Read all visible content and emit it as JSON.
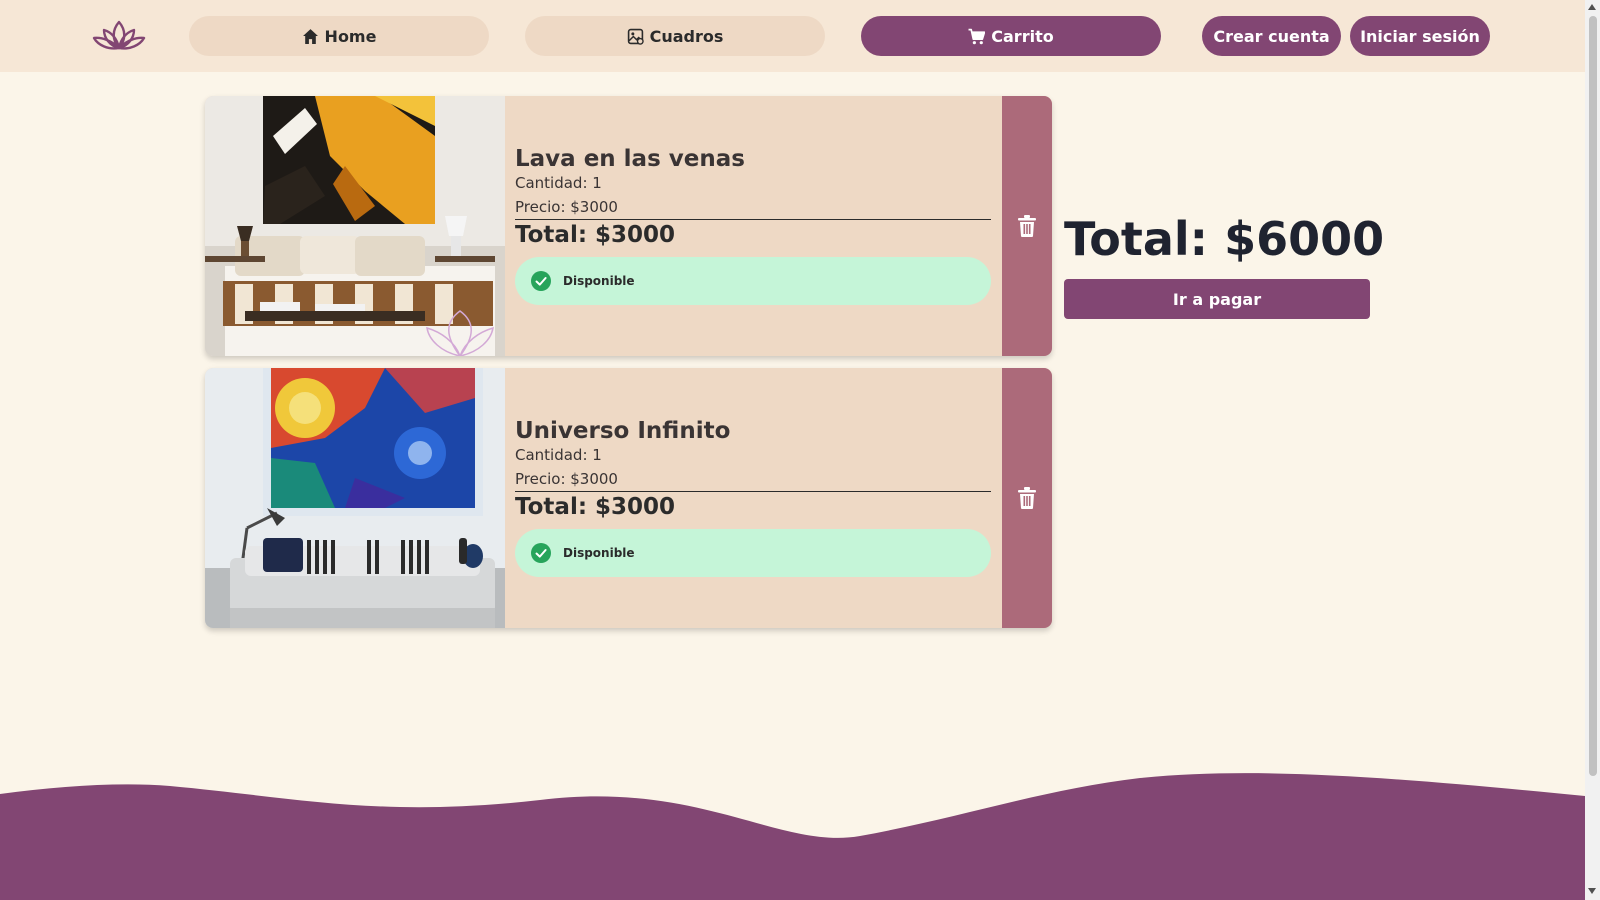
{
  "header": {
    "logo_icon": "lotus-icon",
    "nav": [
      {
        "label": "Home",
        "icon": "home-icon"
      },
      {
        "label": "Cuadros",
        "icon": "picture-icon"
      },
      {
        "label": "Carrito",
        "icon": "cart-icon"
      }
    ],
    "crear_cuenta": "Crear cuenta",
    "iniciar_sesion": "Iniciar sesión"
  },
  "cart": {
    "items": [
      {
        "title": "Lava en las venas",
        "quantity": "Cantidad: 1",
        "price": "Precio: $3000",
        "total": "Total: $3000",
        "status": "Disponible"
      },
      {
        "title": "Universo Infinito",
        "quantity": "Cantidad: 1",
        "price": "Precio: $3000",
        "total": "Total: $3000",
        "status": "Disponible"
      }
    ]
  },
  "summary": {
    "total": "Total: $6000",
    "pay_label": "Ir a pagar"
  },
  "colors": {
    "brand": "#824673",
    "header_bg": "#f6e7d6",
    "card_bg": "#eed9c5",
    "delete_bg": "#ac6a7a",
    "status_bg": "#c5f5d8",
    "page_bg": "#fbf5e9"
  }
}
